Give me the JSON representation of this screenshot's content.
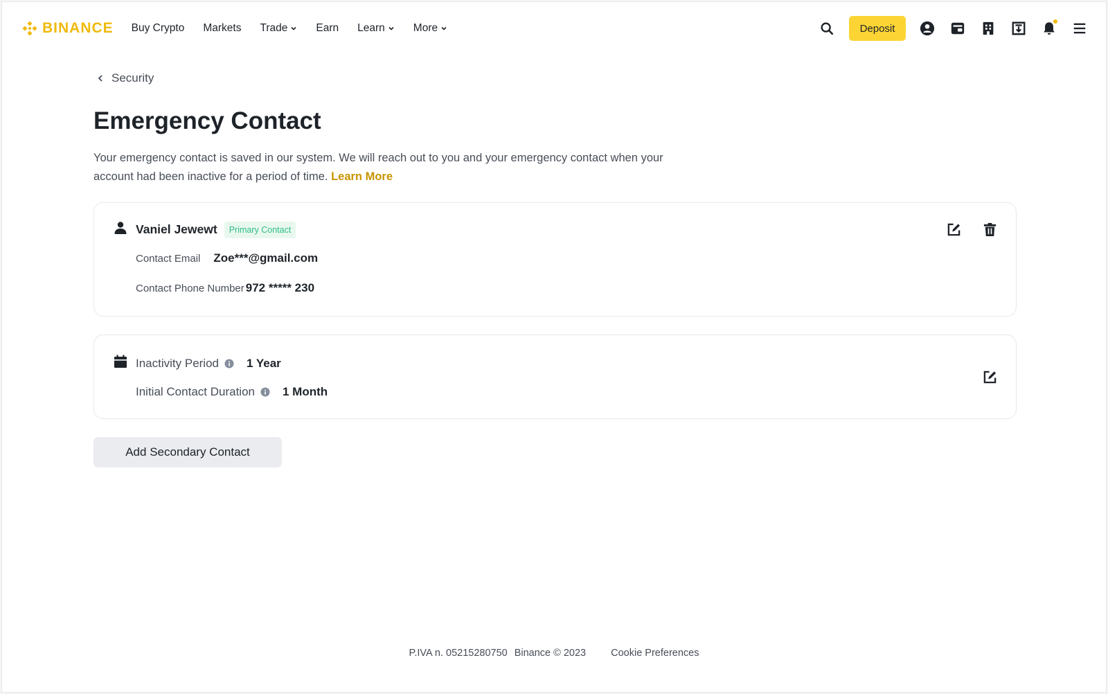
{
  "brand": {
    "name": "BINANCE",
    "color": "#f0b90b"
  },
  "nav": {
    "items": [
      {
        "label": "Buy Crypto",
        "has_dropdown": false
      },
      {
        "label": "Markets",
        "has_dropdown": false
      },
      {
        "label": "Trade",
        "has_dropdown": true
      },
      {
        "label": "Earn",
        "has_dropdown": false
      },
      {
        "label": "Learn",
        "has_dropdown": true
      },
      {
        "label": "More",
        "has_dropdown": true
      }
    ]
  },
  "header": {
    "deposit_label": "Deposit",
    "icons": [
      "search-icon",
      "user-icon",
      "wallet-icon",
      "orders-icon",
      "download-icon",
      "bell-icon",
      "menu-icon"
    ]
  },
  "breadcrumb": {
    "label": "Security"
  },
  "page": {
    "title": "Emergency Contact",
    "description": "Your emergency contact is saved in our system. We will reach out to you and your emergency contact when your account had been inactive for a period of time.",
    "learn_more": "Learn More"
  },
  "contact": {
    "name": "Vaniel Jewewt",
    "badge": "Primary Contact",
    "email_label": "Contact Email",
    "email_value": "Zoe***@gmail.com",
    "phone_label": "Contact Phone Number",
    "phone_value": "972 ***** 230"
  },
  "period": {
    "inactivity_label": "Inactivity Period",
    "inactivity_value": "1 Year",
    "initial_label": "Initial Contact Duration",
    "initial_value": "1 Month"
  },
  "add_secondary_label": "Add Secondary Contact",
  "footer": {
    "piva": "P.IVA n. 05215280750",
    "copyright": "Binance © 2023",
    "cookie": "Cookie Preferences"
  },
  "colors": {
    "accent": "#f0b90b",
    "deposit_bg": "#fcd535",
    "link": "#c99400",
    "badge_bg": "#e9f8ef",
    "badge_text": "#2ebd85"
  }
}
